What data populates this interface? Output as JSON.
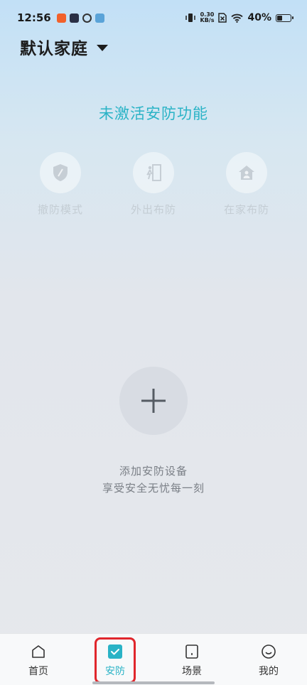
{
  "status_bar": {
    "time": "12:56",
    "net_speed_value": "0.30",
    "net_speed_unit": "KB/s",
    "battery_percent": "40%",
    "battery_level": 0.4
  },
  "header": {
    "family_name": "默认家庭"
  },
  "security": {
    "status_text": "未激活安防功能",
    "modes": [
      {
        "label": "撤防模式",
        "icon": "shield-icon"
      },
      {
        "label": "外出布防",
        "icon": "leave-home-icon"
      },
      {
        "label": "在家布防",
        "icon": "house-icon"
      }
    ]
  },
  "add_device": {
    "line1": "添加安防设备",
    "line2": "享受安全无忧每一刻"
  },
  "bottom_nav": {
    "items": [
      {
        "label": "首页",
        "icon": "home-icon"
      },
      {
        "label": "安防",
        "icon": "security-check-icon",
        "active": true
      },
      {
        "label": "场景",
        "icon": "scene-icon"
      },
      {
        "label": "我的",
        "icon": "profile-icon"
      }
    ]
  },
  "colors": {
    "accent": "#2ab3c6",
    "highlight": "#e0262c"
  }
}
